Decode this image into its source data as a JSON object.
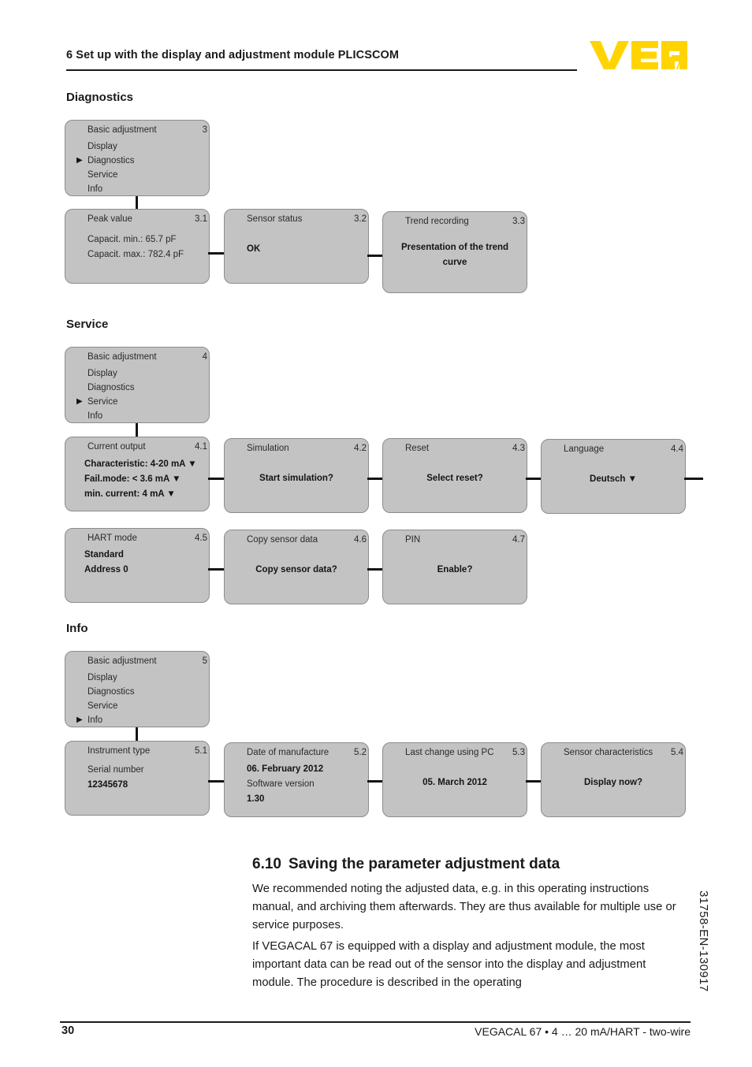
{
  "header": {
    "title": "6 Set up with the display and adjustment module PLICSCOM",
    "logo_alt": "VEGA",
    "logo_color": "#FFD400"
  },
  "sections": {
    "diagnostics": {
      "title": "Diagnostics"
    },
    "service": {
      "title": "Service"
    },
    "info": {
      "title": "Info"
    }
  },
  "diagnostics": {
    "root": {
      "num": "3",
      "items": [
        {
          "label": "Basic adjustment",
          "selected": false
        },
        {
          "label": "Display",
          "selected": false
        },
        {
          "label": "Diagnostics",
          "selected": true
        },
        {
          "label": "Service",
          "selected": false
        },
        {
          "label": "Info",
          "selected": false
        }
      ]
    },
    "boxes": [
      {
        "num": "3.1",
        "title": "Peak value",
        "lines": [
          {
            "text": "",
            "bold": false
          },
          {
            "text": "Capacit. min.: 65.7 pF",
            "bold": false
          },
          {
            "text": "Capacit. max.: 782.4 pF",
            "bold": false
          }
        ]
      },
      {
        "num": "3.2",
        "title": "Sensor status",
        "lines": [
          {
            "text": "OK",
            "bold": true
          }
        ]
      },
      {
        "num": "3.3",
        "title": "Trend recording",
        "lines": [
          {
            "text": "Presentation of the trend curve",
            "bold": true
          }
        ]
      }
    ]
  },
  "service": {
    "root": {
      "num": "4",
      "items": [
        {
          "label": "Basic adjustment",
          "selected": false
        },
        {
          "label": "Display",
          "selected": false
        },
        {
          "label": "Diagnostics",
          "selected": false
        },
        {
          "label": "Service",
          "selected": true
        },
        {
          "label": "Info",
          "selected": false
        }
      ]
    },
    "boxes": [
      {
        "num": "4.1",
        "title": "Current output",
        "lines": [
          {
            "text": "Characteristic: 4-20 mA ▼",
            "bold": true
          },
          {
            "text": "Fail.mode: < 3.6 mA ▼",
            "bold": true
          },
          {
            "text": "min. current: 4 mA ▼",
            "bold": true
          }
        ]
      },
      {
        "num": "4.2",
        "title": "Simulation",
        "lines": [
          {
            "text": "Start simulation?",
            "bold": true
          }
        ]
      },
      {
        "num": "4.3",
        "title": "Reset",
        "lines": [
          {
            "text": "Select reset?",
            "bold": true
          }
        ]
      },
      {
        "num": "4.4",
        "title": "Language",
        "lines": [
          {
            "text": "Deutsch ▼",
            "bold": true
          }
        ]
      },
      {
        "num": "4.5",
        "title": "HART mode",
        "lines": [
          {
            "text": "Standard",
            "bold": true
          },
          {
            "text": "Address 0",
            "bold": true
          }
        ]
      },
      {
        "num": "4.6",
        "title": "Copy sensor data",
        "lines": [
          {
            "text": "Copy sensor data?",
            "bold": true
          }
        ]
      },
      {
        "num": "4.7",
        "title": "PIN",
        "lines": [
          {
            "text": "Enable?",
            "bold": true
          }
        ]
      }
    ]
  },
  "info": {
    "root": {
      "num": "5",
      "items": [
        {
          "label": "Basic adjustment",
          "selected": false
        },
        {
          "label": "Display",
          "selected": false
        },
        {
          "label": "Diagnostics",
          "selected": false
        },
        {
          "label": "Service",
          "selected": false
        },
        {
          "label": "Info",
          "selected": true
        }
      ]
    },
    "boxes": [
      {
        "num": "5.1",
        "title": "Instrument type",
        "lines": [
          {
            "text": "",
            "bold": false
          },
          {
            "text": "Serial number",
            "bold": false
          },
          {
            "text": "12345678",
            "bold": true
          }
        ]
      },
      {
        "num": "5.2",
        "title": "Date of manufacture",
        "lines": [
          {
            "text": "06. February 2012",
            "bold": true
          },
          {
            "text": "Software version",
            "bold": false
          },
          {
            "text": "1.30",
            "bold": true
          }
        ]
      },
      {
        "num": "5.3",
        "title": "Last change using PC",
        "lines": [
          {
            "text": "05. March 2012",
            "bold": true
          }
        ]
      },
      {
        "num": "5.4",
        "title": "Sensor characteristics",
        "lines": [
          {
            "text": "Display now?",
            "bold": true
          }
        ]
      }
    ]
  },
  "article": {
    "heading_number": "6.10",
    "heading_text": "Saving the parameter adjustment data",
    "paragraph1": "We recommended noting the adjusted data, e.g. in this operating instructions manual, and archiving them afterwards. They are thus available for multiple use or service purposes.",
    "paragraph2": "If VEGACAL 67 is equipped with a display and adjustment module, the most important data can be read out of the sensor into the display and adjustment module. The procedure is described in the operating"
  },
  "doc_number_vertical": "31758-EN-130917",
  "footer": {
    "page": "30",
    "product": "VEGACAL 67 • 4 … 20 mA/HART - two-wire"
  }
}
